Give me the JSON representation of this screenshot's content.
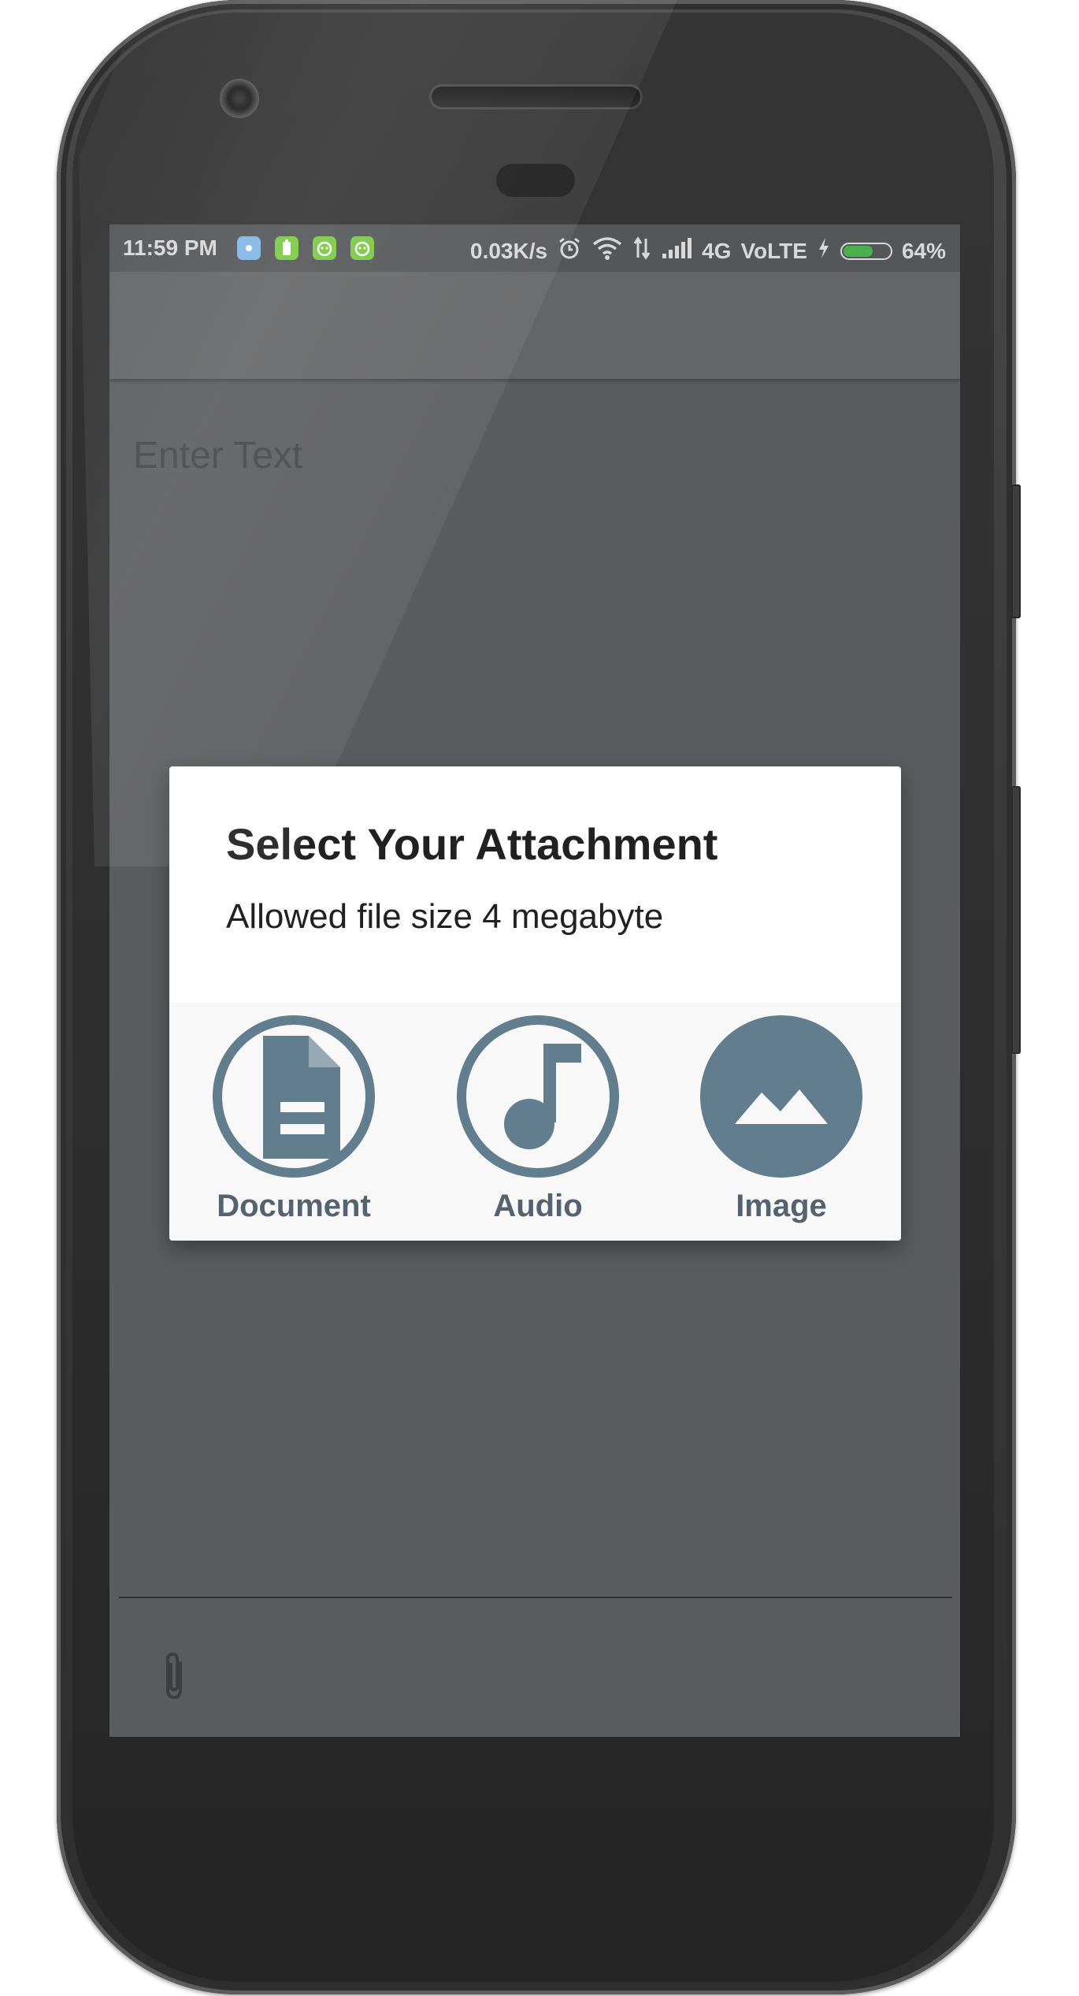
{
  "status_bar": {
    "time": "11:59 PM",
    "net_speed": "0.03K/s",
    "network_type": "4G",
    "volte": "VoLTE",
    "battery_percent": "64%",
    "battery_level": 0.64,
    "notif_icons": [
      "info-icon",
      "battery-app-icon",
      "android-icon",
      "android-icon"
    ],
    "notif_colors": [
      "#7fb6e6",
      "#7ac943",
      "#7ac943",
      "#7ac943"
    ]
  },
  "editor": {
    "placeholder": "Enter Text"
  },
  "dialog": {
    "title": "Select Your Attachment",
    "subtitle": "Allowed file size 4 megabyte",
    "options": [
      {
        "label": "Document",
        "icon": "document-icon"
      },
      {
        "label": "Audio",
        "icon": "music-note-icon"
      },
      {
        "label": "Image",
        "icon": "image-icon"
      }
    ]
  },
  "colors": {
    "icon_accent": "#627d8e",
    "label_color": "#556270",
    "scrim_screen": "#5b5c5f",
    "battery_fill": "#4caf50"
  }
}
